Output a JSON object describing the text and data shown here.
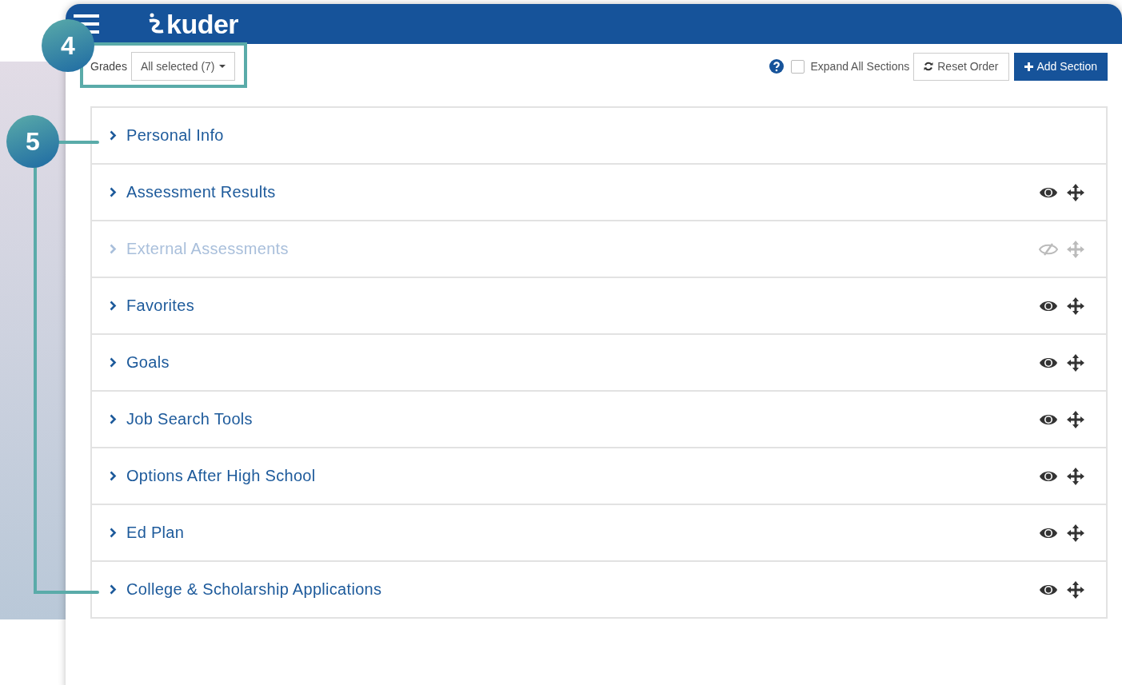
{
  "header": {
    "logo": "kuder"
  },
  "toolbar": {
    "grades_label": "Grades",
    "grades_value": "All selected (7)",
    "expand_all": {
      "label": "Expand All Sections",
      "checked": false
    },
    "reset_button": "Reset Order",
    "add_button": "Add Section"
  },
  "sections": [
    {
      "title": "Personal Info",
      "fixed": true,
      "hidden": false
    },
    {
      "title": "Assessment Results",
      "fixed": false,
      "hidden": false
    },
    {
      "title": "External Assessments",
      "fixed": false,
      "hidden": true
    },
    {
      "title": "Favorites",
      "fixed": false,
      "hidden": false
    },
    {
      "title": "Goals",
      "fixed": false,
      "hidden": false
    },
    {
      "title": "Job Search Tools",
      "fixed": false,
      "hidden": false
    },
    {
      "title": "Options After High School",
      "fixed": false,
      "hidden": false
    },
    {
      "title": "Ed Plan",
      "fixed": false,
      "hidden": false
    },
    {
      "title": "College & Scholarship Applications",
      "fixed": false,
      "hidden": false
    }
  ],
  "callouts": [
    {
      "label": "4"
    },
    {
      "label": "5"
    }
  ]
}
